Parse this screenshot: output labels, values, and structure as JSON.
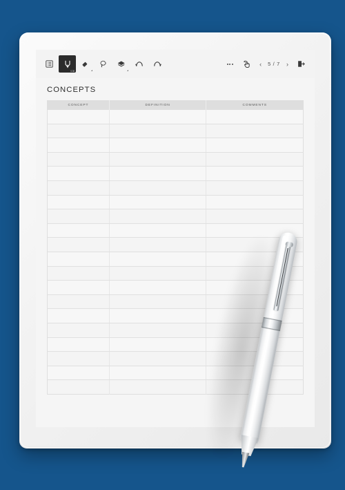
{
  "background": {
    "color": "#15558c"
  },
  "device": {
    "name": "e-ink-tablet",
    "bezel_color": "#f2f2f2"
  },
  "toolbar": {
    "left_tools": [
      {
        "id": "menu",
        "icon": "list-menu-icon",
        "label": "Menu",
        "selected": false,
        "sublabel": ""
      },
      {
        "id": "pen",
        "icon": "pen-icon",
        "label": "Pen",
        "selected": true,
        "sublabel": "0.30"
      },
      {
        "id": "eraser",
        "icon": "eraser-icon",
        "label": "Eraser",
        "selected": false,
        "sublabel": ""
      },
      {
        "id": "lasso",
        "icon": "lasso-select-icon",
        "label": "Select",
        "selected": false,
        "sublabel": ""
      },
      {
        "id": "layers",
        "icon": "layers-icon",
        "label": "Layers",
        "selected": false,
        "sublabel": ""
      },
      {
        "id": "undo",
        "icon": "undo-arrow-icon",
        "label": "Undo",
        "selected": false,
        "sublabel": ""
      },
      {
        "id": "redo",
        "icon": "redo-arrow-icon",
        "label": "Redo",
        "selected": false,
        "sublabel": ""
      }
    ],
    "right_tools": [
      {
        "id": "more",
        "icon": "more-options-icon",
        "label": "More"
      },
      {
        "id": "touch",
        "icon": "hand-touch-icon",
        "label": "Touch Gesture"
      }
    ],
    "pagination": {
      "prev_label": "‹",
      "next_label": "›",
      "current_page": 5,
      "total_pages": 7,
      "display": "5 / 7"
    },
    "exit": {
      "icon": "exit-export-icon",
      "label": "Exit"
    }
  },
  "page": {
    "title": "CONCEPTS",
    "table": {
      "columns": [
        {
          "key": "concept",
          "header": "CONCEPT"
        },
        {
          "key": "definition",
          "header": "DEFINITION"
        },
        {
          "key": "comments",
          "header": "COMMENTS"
        }
      ],
      "row_count": 20,
      "rows": [
        {
          "concept": "",
          "definition": "",
          "comments": ""
        },
        {
          "concept": "",
          "definition": "",
          "comments": ""
        },
        {
          "concept": "",
          "definition": "",
          "comments": ""
        },
        {
          "concept": "",
          "definition": "",
          "comments": ""
        },
        {
          "concept": "",
          "definition": "",
          "comments": ""
        },
        {
          "concept": "",
          "definition": "",
          "comments": ""
        },
        {
          "concept": "",
          "definition": "",
          "comments": ""
        },
        {
          "concept": "",
          "definition": "",
          "comments": ""
        },
        {
          "concept": "",
          "definition": "",
          "comments": ""
        },
        {
          "concept": "",
          "definition": "",
          "comments": ""
        },
        {
          "concept": "",
          "definition": "",
          "comments": ""
        },
        {
          "concept": "",
          "definition": "",
          "comments": ""
        },
        {
          "concept": "",
          "definition": "",
          "comments": ""
        },
        {
          "concept": "",
          "definition": "",
          "comments": ""
        },
        {
          "concept": "",
          "definition": "",
          "comments": ""
        },
        {
          "concept": "",
          "definition": "",
          "comments": ""
        },
        {
          "concept": "",
          "definition": "",
          "comments": ""
        },
        {
          "concept": "",
          "definition": "",
          "comments": ""
        },
        {
          "concept": "",
          "definition": "",
          "comments": ""
        },
        {
          "concept": "",
          "definition": "",
          "comments": ""
        }
      ]
    }
  },
  "stylus": {
    "name": "stylus-pen",
    "body_color": "#ffffff",
    "accent_color": "#b9bdc1"
  }
}
